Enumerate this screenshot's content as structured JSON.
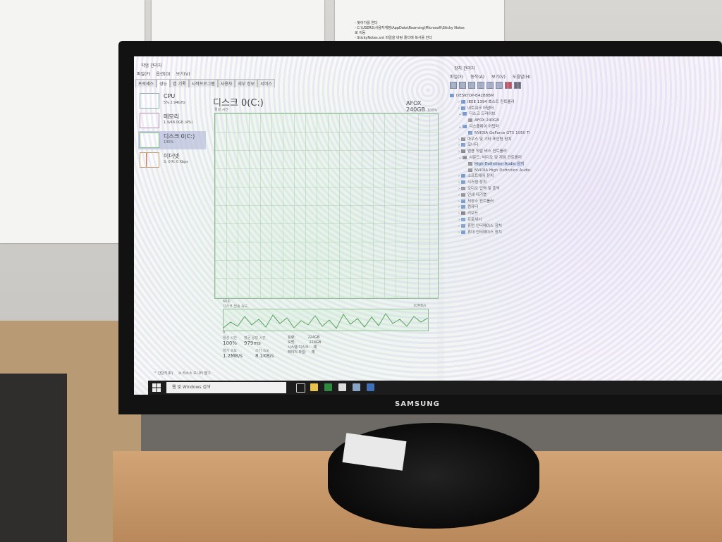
{
  "scene": {
    "monitor_brand": "SAMSUNG",
    "notes_paper_lines": [
      "- 찾아가를 연다",
      "- C:\\USERS\\사용자계정\\AppData\\Roaming\\Microsoft\\Sticky Notes",
      "로 이동",
      "- StickyNotes.snt 파일을 바탕 폴더에 복사를 한다"
    ]
  },
  "task_manager": {
    "title": "작업 관리자",
    "menu": [
      "파일(F)",
      "옵션(O)",
      "보기(V)"
    ],
    "tabs": [
      "프로세스",
      "성능",
      "앱 기록",
      "시작프로그램",
      "사용자",
      "세부 정보",
      "서비스"
    ],
    "resources": [
      {
        "name": "CPU",
        "value": "5% 2.94GHz"
      },
      {
        "name": "메모리",
        "value": "1.9/48.0GB (4%)"
      },
      {
        "name": "디스크 0(C:)",
        "value": "100%"
      },
      {
        "name": "이더넷",
        "value": "S: 0 R: 0 Kbps"
      }
    ],
    "disk_title": "디스크 0(C:)",
    "disk_model": "AFOX 240GB",
    "graph_label": "활성 시간",
    "graph_max": "100%",
    "graph_time": "60초",
    "graph_min": "0",
    "transfer_label": "디스크 전송 속도",
    "transfer_max": "10MB/s",
    "stats": {
      "active_time_label": "활성 시간",
      "active_time": "100%",
      "response_label": "평균 응답 시간",
      "response": "979ms",
      "read_label": "읽기 속도",
      "read": "1.2MB/s",
      "write_label": "쓰기 속도",
      "write": "8.1KB/s",
      "capacity_label": "용량:",
      "capacity": "224GB",
      "formatted_label": "포맷:",
      "formatted": "224GB",
      "system_label": "시스템 디스크:",
      "system": "예",
      "pagefile_label": "페이지 파일:",
      "pagefile": "예"
    },
    "footer_brief": "간단히(D)",
    "footer_monitor": "리소스 모니터 열기"
  },
  "taskbar": {
    "search_placeholder": "웹 및 Windows 검색"
  },
  "device_manager": {
    "title": "장치 관리자",
    "menu": [
      "파일(F)",
      "동작(A)",
      "보기(V)",
      "도움말(H)"
    ],
    "tree": [
      {
        "label": "DESKTOP-B42B8BM",
        "level": 0
      },
      {
        "label": "IEEE 1394 호스트 컨트롤러",
        "level": 1
      },
      {
        "label": "네트워크 어댑터",
        "level": 1
      },
      {
        "label": "디스크 드라이브",
        "level": 1
      },
      {
        "label": "AFOX 240GB",
        "level": 2
      },
      {
        "label": "디스플레이 어댑터",
        "level": 1
      },
      {
        "label": "NVIDIA GeForce GTX 1050 Ti",
        "level": 2
      },
      {
        "label": "마우스 및 기타 포인팅 장치",
        "level": 1
      },
      {
        "label": "모니터",
        "level": 1
      },
      {
        "label": "범용 직렬 버스 컨트롤러",
        "level": 1
      },
      {
        "label": "사운드, 비디오 및 게임 컨트롤러",
        "level": 1
      },
      {
        "label": "High Definition Audio 장치",
        "level": 2,
        "selected": true
      },
      {
        "label": "NVIDIA High Definition Audio",
        "level": 2
      },
      {
        "label": "소프트웨어 장치",
        "level": 1
      },
      {
        "label": "시스템 장치",
        "level": 1
      },
      {
        "label": "오디오 입력 및 출력",
        "level": 1
      },
      {
        "label": "인쇄 대기열",
        "level": 1
      },
      {
        "label": "저장소 컨트롤러",
        "level": 1
      },
      {
        "label": "컴퓨터",
        "level": 1
      },
      {
        "label": "키보드",
        "level": 1
      },
      {
        "label": "프로세서",
        "level": 1
      },
      {
        "label": "휴먼 인터페이스 장치",
        "level": 1
      },
      {
        "label": "휴대 인터페이스 장치",
        "level": 1
      }
    ]
  }
}
